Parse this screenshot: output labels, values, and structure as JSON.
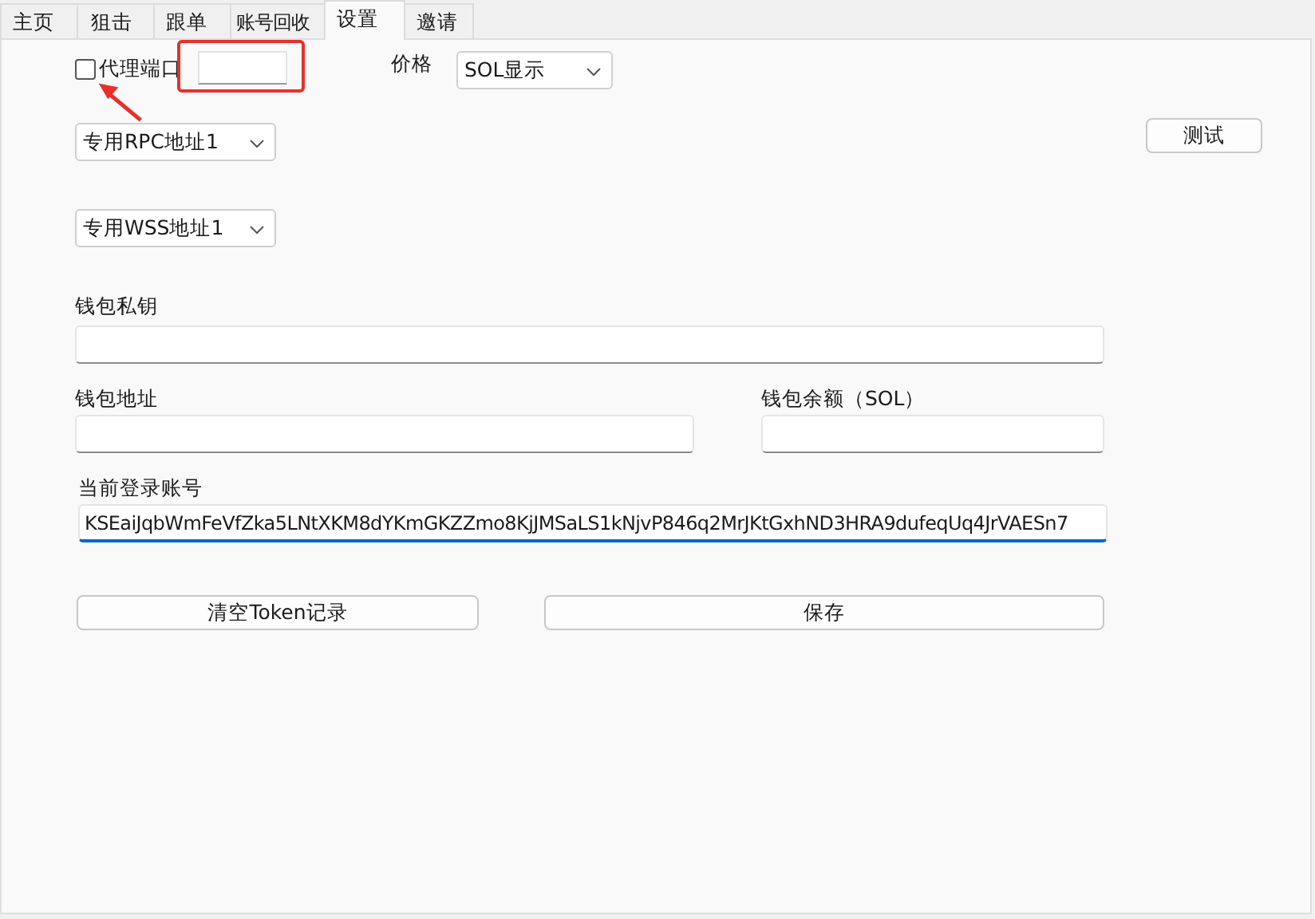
{
  "tabs": [
    {
      "label": "主页",
      "selected": false
    },
    {
      "label": "狙击",
      "selected": false
    },
    {
      "label": "跟单",
      "selected": false
    },
    {
      "label": "账号回收",
      "selected": false
    },
    {
      "label": "设置",
      "selected": true
    },
    {
      "label": "邀请",
      "selected": false
    }
  ],
  "proxy": {
    "label": "代理端口",
    "checked": false
  },
  "price": {
    "label": "价格",
    "value": "SOL显示"
  },
  "rpc_select": "专用RPC地址1",
  "test_button": "测试",
  "wss_select": "专用WSS地址1",
  "private_key": {
    "label": "钱包私钥"
  },
  "address": {
    "label": "钱包地址"
  },
  "balance": {
    "label": "钱包余额（SOL）"
  },
  "account": {
    "label": "当前登录账号",
    "value": "KSEaiJqbWmFeVfZka5LNtXKM8dYKmGKZZmo8KjJMSaLS1kNjvP846q2MrJKtGxhND3HRA9dufeqUq4JrVAESn7",
    "focused": true
  },
  "buttons": [
    "清空Token记录",
    "保存"
  ]
}
